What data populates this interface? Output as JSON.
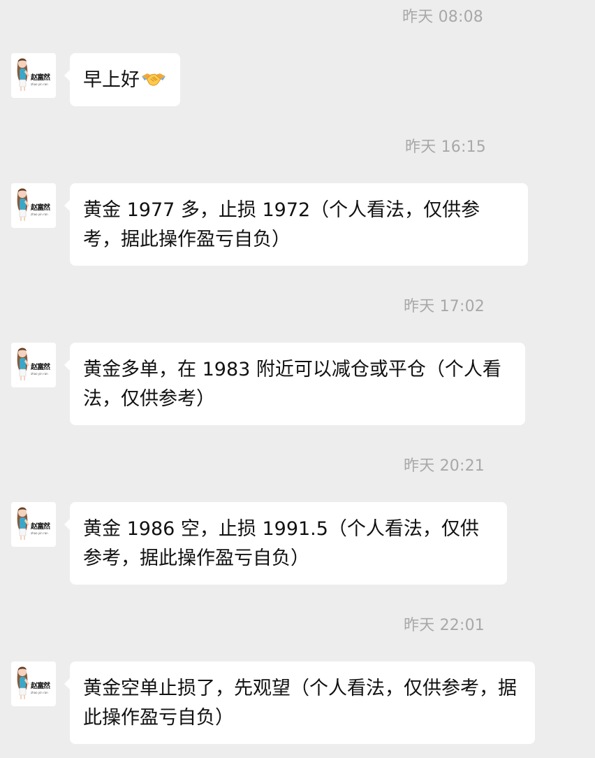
{
  "messages": [
    {
      "timestamp": "昨天 08:08",
      "text": "早上好",
      "emoji": "handshake-icon"
    },
    {
      "timestamp": "昨天 16:15",
      "text": "黄金 1977 多，止损 1972（个人看法，仅供参考，据此操作盈亏自负）"
    },
    {
      "timestamp": "昨天 17:02",
      "text": "黄金多单，在 1983 附近可以减仓或平仓（个人看法，仅供参考）"
    },
    {
      "timestamp": "昨天 20:21",
      "text": "黄金 1986 空，止损 1991.5（个人看法，仅供参考，据此操作盈亏自负）"
    },
    {
      "timestamp": "昨天 22:01",
      "text": "黄金空单止损了，先观望（个人看法，仅供参考，据此操作盈亏自负）"
    }
  ],
  "avatar": {
    "signature": "赵富然",
    "romanized": "zhao yin ran"
  },
  "colors": {
    "background": "#ededed",
    "bubble": "#ffffff",
    "timestamp": "#a8a8a8",
    "text": "#111111"
  }
}
